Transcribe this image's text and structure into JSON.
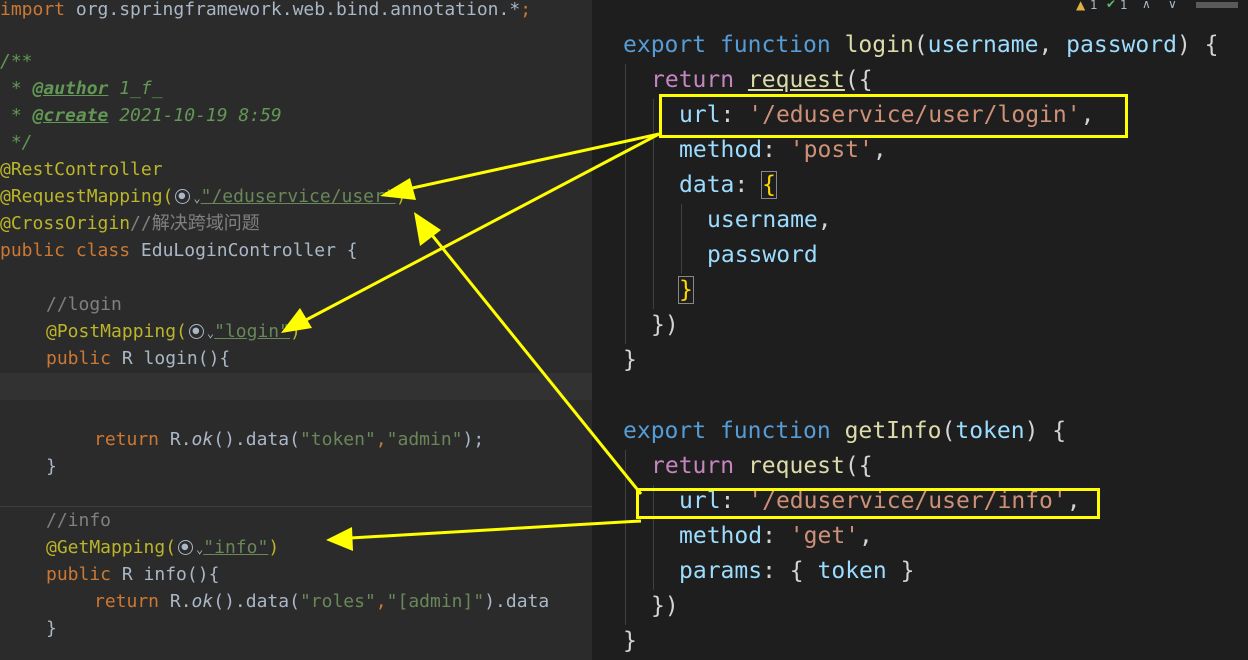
{
  "java": {
    "import_kw": "import ",
    "import_pkg": "org.springframework.web.bind.annotation.*",
    "import_end": ";",
    "doc_open": "/**",
    "doc_star": " * ",
    "author_tag": "@author",
    "author_val": " 1_f_",
    "create_tag": "@create",
    "create_val": " 2021-10-19 8:59",
    "doc_close": " */",
    "rest_controller": "@RestController",
    "request_mapping": "@RequestMapping(",
    "request_mapping_path": "\"/eduservice/user\"",
    "paren_close": ")",
    "cross_origin": "@CrossOrigin",
    "cross_origin_comment": "//解决跨域问题",
    "class_kw": "public class ",
    "class_name": "EduLoginController {",
    "login_comment": "//login",
    "post_mapping": "@PostMapping(",
    "post_mapping_path": "\"login\"",
    "public_r": "public ",
    "r_type": "R ",
    "login_method": "login(){",
    "return_kw": "return ",
    "r_ok": "R.",
    "ok_fn": "ok",
    "data_call": "().data(",
    "token_key": "\"token\"",
    "comma": ",",
    "admin_val": "\"admin\"",
    "stmt_end": ");",
    "brace_close": "}",
    "info_comment": "//info",
    "get_mapping": "@GetMapping(",
    "get_mapping_path": "\"info\"",
    "info_method": "info(){",
    "roles_key": "\"roles\"",
    "roles_val": "\"[admin]\"",
    "data_tail": ").data"
  },
  "js": {
    "export_kw": "export ",
    "function_kw": "function ",
    "login_fn": "login",
    "login_params_open": "(",
    "username": "username",
    "comma_sp": ", ",
    "password": "password",
    "login_params_close": ") {",
    "return_kw": "return ",
    "request_fn": "request",
    "open_call": "({",
    "url_key": "url",
    "colon": ": ",
    "login_url": "'/eduservice/user/login'",
    "comma": ",",
    "method_key": "method",
    "post_val": "'post'",
    "data_key": "data",
    "brace_open": "{",
    "brace_close": "}",
    "close_call": "})",
    "getinfo_fn": "getInfo",
    "getinfo_params_open": "(",
    "token": "token",
    "getinfo_params_close": ") {",
    "info_url": "'/eduservice/user/info'",
    "get_val": "'get'",
    "params_key": "params",
    "params_val_open": "{ ",
    "params_val_close": " }"
  },
  "topbar": {
    "warn_count": "1",
    "check_count": "1",
    "up": "∧",
    "down": "∨"
  },
  "colors": {
    "arrow": "#ffff00",
    "left_bg": "#2b2b2b",
    "right_bg": "#1e1e1e"
  }
}
